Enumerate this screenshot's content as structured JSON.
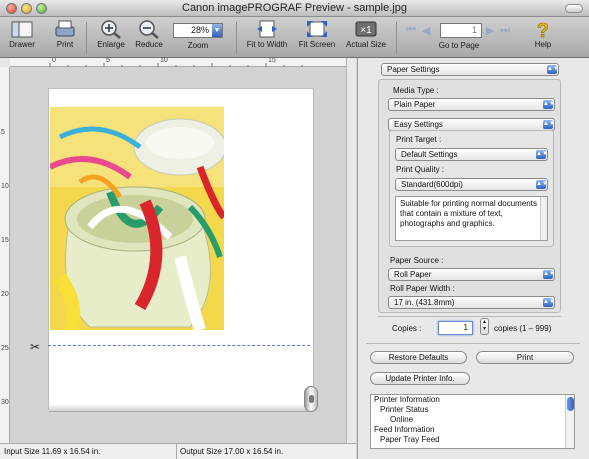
{
  "window": {
    "title": "Canon imagePROGRAF Preview - sample.jpg"
  },
  "toolbar": {
    "drawer": "Drawer",
    "print": "Print",
    "enlarge": "Enlarge",
    "reduce": "Reduce",
    "zoom_value": "28%",
    "zoom": "Zoom",
    "fit_to_width": "Fit to Width",
    "fit_screen": "Fit Screen",
    "actual_size": "Actual Size",
    "actual_size_icon_text": "×1",
    "page_value": "1",
    "go_to_page": "Go to Page",
    "help": "Help",
    "help_icon_text": "?"
  },
  "ruler": {
    "h": [
      "0",
      "5",
      "10",
      "15"
    ],
    "v": [
      "5",
      "10",
      "15",
      "20",
      "25",
      "30"
    ]
  },
  "statusbar": {
    "input_size": "Input Size 11.69 x 16.54 in.",
    "output_size": "Output Size 17.00 x 16.54 in."
  },
  "panel": {
    "section": "Paper Settings",
    "media_type_label": "Media Type :",
    "media_type": "Plain Paper",
    "mode": "Easy Settings",
    "print_target_label": "Print Target :",
    "print_target": "Default Settings",
    "print_quality_label": "Print Quality :",
    "print_quality": "Standard(600dpi)",
    "description": "Suitable for printing normal documents that contain a mixture of text, photographs and graphics.",
    "paper_source_label": "Paper Source :",
    "paper_source": "Roll Paper",
    "roll_width_label": "Roll Paper Width :",
    "roll_width": "17 in. (431.8mm)",
    "copies_label": "Copies :",
    "copies_value": "1",
    "copies_range": "copies (1 – 999)",
    "restore_defaults": "Restore Defaults",
    "print_button": "Print",
    "update_printer_info": "Update Printer Info.",
    "printer_info": [
      "Printer Information",
      "Printer Status",
      "Online",
      "Feed Information",
      "Paper Tray Feed"
    ]
  },
  "colors": {
    "accent": "#2f63c0",
    "photo_background": "#f2d84a",
    "cut_line": "#5577dd"
  }
}
